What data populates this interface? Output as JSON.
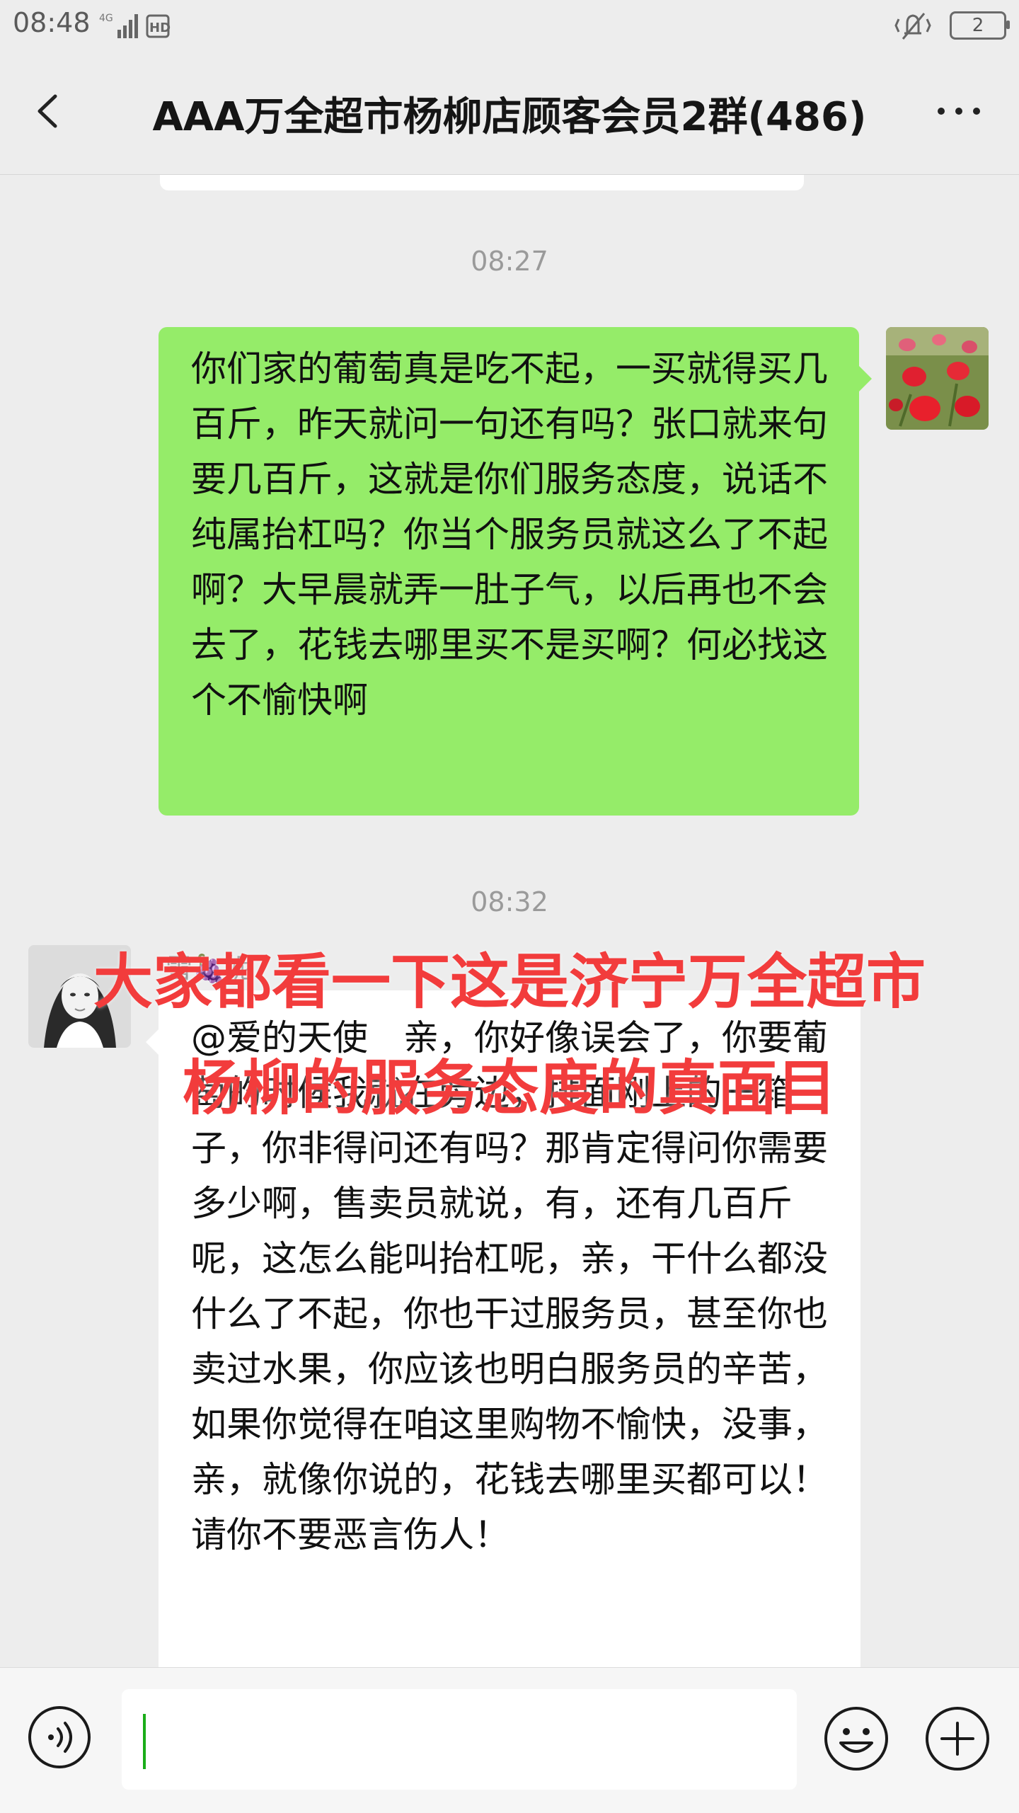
{
  "status_bar": {
    "time": "08:48",
    "network_label": "4G",
    "hd_label": "HD",
    "battery_level": "2"
  },
  "header": {
    "title": "AAA万全超市杨柳店顾客会员2群(486)",
    "back_icon": "chevron-left-icon",
    "more_icon": "more-dots-icon"
  },
  "chat": {
    "timestamp_1": "08:27",
    "timestamp_2": "08:32",
    "messages": [
      {
        "side": "right",
        "text": "你们家的葡萄真是吃不起，一买就得买几百斤，昨天就问一句还有吗？张口就来句要几百斤，这就是你们服务态度，说话不纯属抬杠吗？你当个服务员就这么了不起啊？大早晨就弄一肚子气，以后再也不会去了，花钱去哪里买不是买啊？何必找这个不愉快啊"
      },
      {
        "side": "left",
        "sender": "雪🍇妮",
        "text": "@爱的天使　亲，你好像误会了，你要葡萄的时候我就在旁边，排面刚上的一箱子，你非得问还有吗？那肯定得问你需要多少啊，售卖员就说，有，还有几百斤呢，这怎么能叫抬杠呢，亲，干什么都没什么了不起，你也干过服务员，甚至你也卖过水果，你应该也明白服务员的辛苦，如果你觉得在咱这里购物不愉快，没事，亲，就像你说的，花钱去哪里买都可以！请你不要恶言伤人！"
      }
    ]
  },
  "overlay": {
    "caption": "大家都看一下这是济宁万全超市杨柳的服务态度的真面目"
  },
  "input_bar": {
    "voice_icon": "voice-icon",
    "emoji_icon": "emoji-icon",
    "plus_icon": "plus-icon",
    "input_value": ""
  },
  "colors": {
    "background": "#ededed",
    "sent_bubble": "#95ec69",
    "received_bubble": "#ffffff",
    "overlay_text": "#f23c3c"
  }
}
